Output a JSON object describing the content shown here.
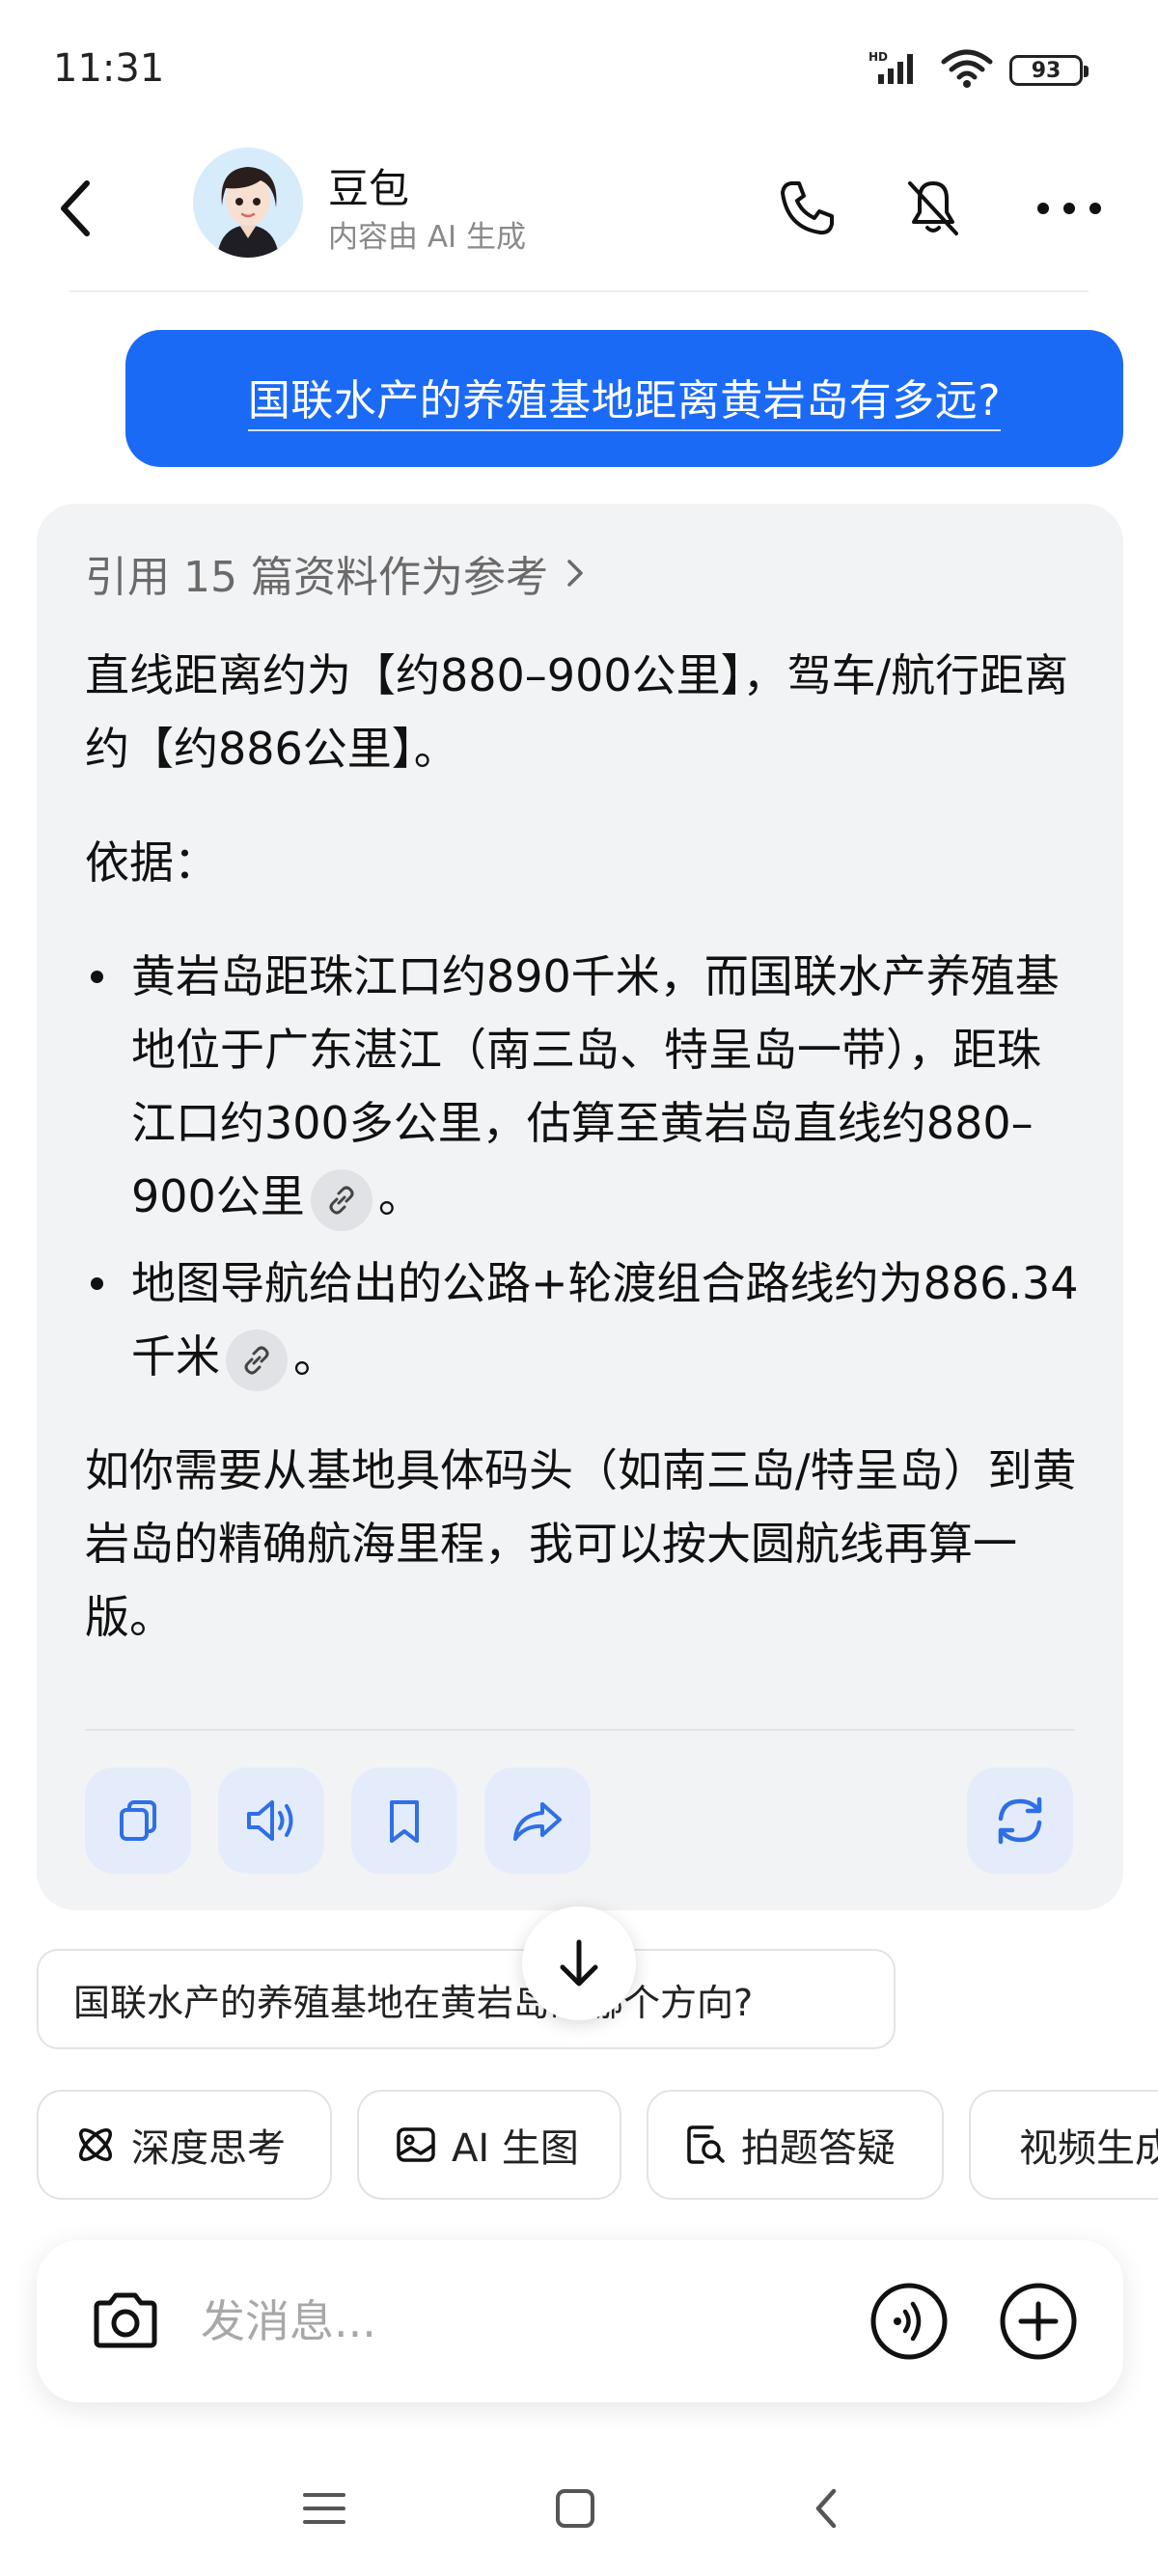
{
  "status_bar": {
    "time": "11:31",
    "battery": "93",
    "network_label": "HD"
  },
  "header": {
    "bot_name": "豆包",
    "bot_subtitle": "内容由 AI 生成",
    "icons": [
      "back-arrow-icon",
      "phone-icon",
      "mute-icon",
      "more-icon"
    ]
  },
  "user_message": "国联水产的养殖基地距离黄岩岛有多远?",
  "answer": {
    "refs_label": "引用 15 篇资料作为参考",
    "intro": "直线距离约为【约880–900公里】，驾车/航行距离约【约886公里】。",
    "basis_label": "依据：",
    "bullets": [
      {
        "text": "黄岩岛距珠江口约890千米，而国联水产养殖基地位于广东湛江（南三岛、特呈岛一带），距珠江口约300多公里，估算至黄岩岛直线约880–900公里",
        "suffix": "。"
      },
      {
        "text": "地图导航给出的公路+轮渡组合路线约为886.34千米",
        "suffix": "。"
      }
    ],
    "closing": "如你需要从基地具体码头（如南三岛/特呈岛）到黄岩岛的精确航海里程，我可以按大圆航线再算一版。",
    "actions": [
      "copy-icon",
      "speaker-icon",
      "bookmark-icon",
      "share-icon",
      "regenerate-icon"
    ]
  },
  "suggestion": "国联水产的养殖基地在黄岩岛的哪个方向?",
  "tools": [
    {
      "label": "深度思考",
      "icon": "atom-icon"
    },
    {
      "label": "AI 生图",
      "icon": "image-icon"
    },
    {
      "label": "拍题答疑",
      "icon": "scan-question-icon"
    },
    {
      "label": "视频生成",
      "icon": "video-icon"
    }
  ],
  "input": {
    "placeholder": "发消息..."
  },
  "colors": {
    "accent": "#1b6af6",
    "card_bg": "#f2f3f5",
    "action_bg": "#e4ecfb",
    "icon_blue": "#2f6fe6"
  }
}
